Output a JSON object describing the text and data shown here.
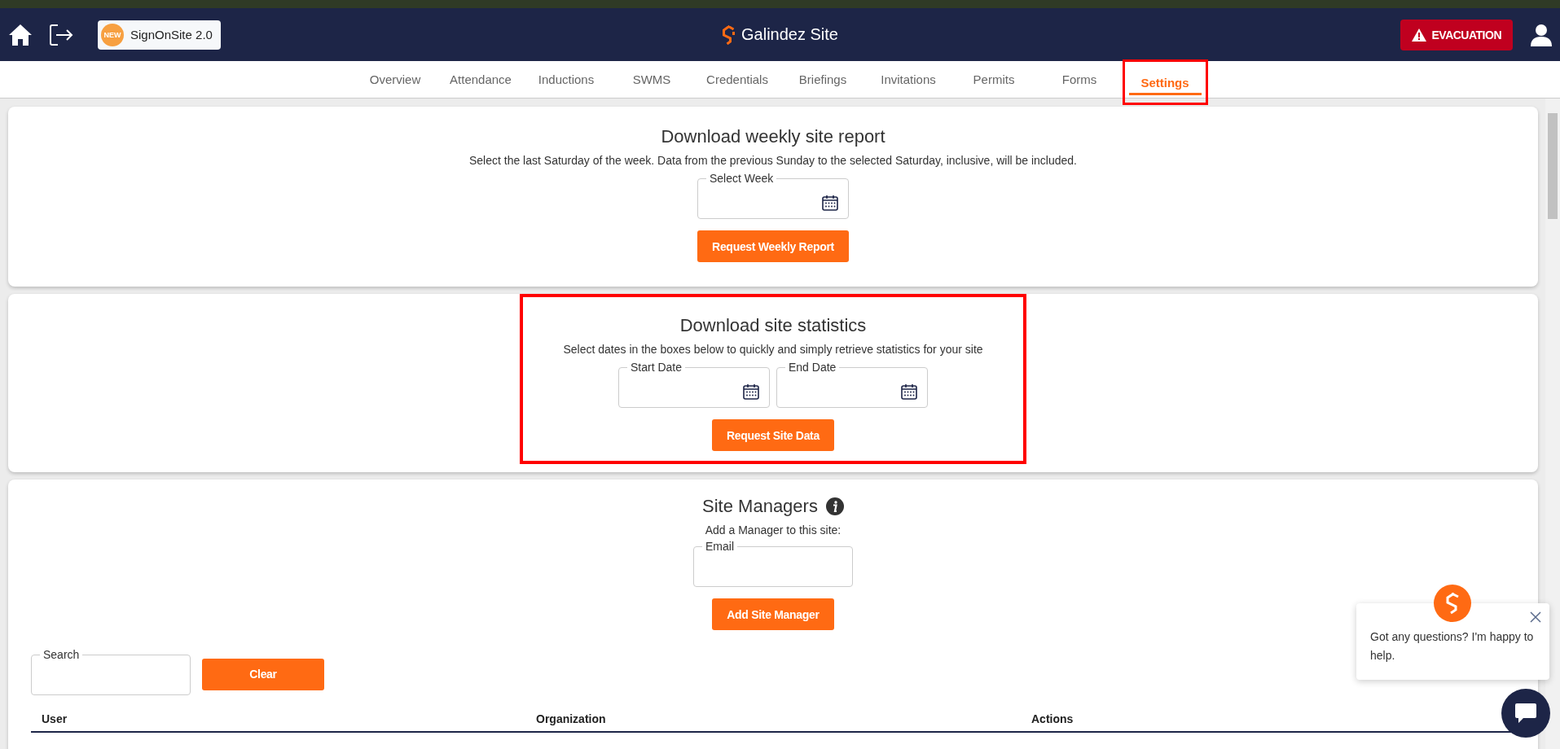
{
  "header": {
    "badge": "NEW",
    "app_button": "SignOnSite 2.0",
    "site_title": "Galindez Site",
    "evacuation_button": "EVACUATION"
  },
  "tabs": [
    {
      "label": "Overview",
      "selected": false,
      "highlighted": false
    },
    {
      "label": "Attendance",
      "selected": false,
      "highlighted": false
    },
    {
      "label": "Inductions",
      "selected": false,
      "highlighted": false
    },
    {
      "label": "SWMS",
      "selected": false,
      "highlighted": false
    },
    {
      "label": "Credentials",
      "selected": false,
      "highlighted": false
    },
    {
      "label": "Briefings",
      "selected": false,
      "highlighted": false
    },
    {
      "label": "Invitations",
      "selected": false,
      "highlighted": false
    },
    {
      "label": "Permits",
      "selected": false,
      "highlighted": false
    },
    {
      "label": "Forms",
      "selected": false,
      "highlighted": false
    },
    {
      "label": "Settings",
      "selected": true,
      "highlighted": true
    }
  ],
  "report_cards": [
    {
      "title": "Download weekly site report",
      "description": "Select the last Saturday of the week. Data from the previous Sunday to the selected Saturday, inclusive, will be included.",
      "fields": [
        {
          "label": "Select Week"
        }
      ],
      "button": "Request Weekly Report",
      "highlighted": false
    },
    {
      "title": "Download site statistics",
      "description": "Select dates in the boxes below to quickly and simply retrieve statistics for your site",
      "fields": [
        {
          "label": "Start Date"
        },
        {
          "label": "End Date"
        }
      ],
      "button": "Request Site Data",
      "highlighted": true
    }
  ],
  "site_managers": {
    "title": "Site Managers",
    "subtitle": "Add a Manager to this site:",
    "email_label": "Email",
    "button": "Add Site Manager",
    "search_label": "Search",
    "clear_button": "Clear",
    "columns": [
      "User",
      "Organization",
      "Actions"
    ]
  },
  "chat": {
    "message": "Got any questions? I'm happy to help."
  }
}
